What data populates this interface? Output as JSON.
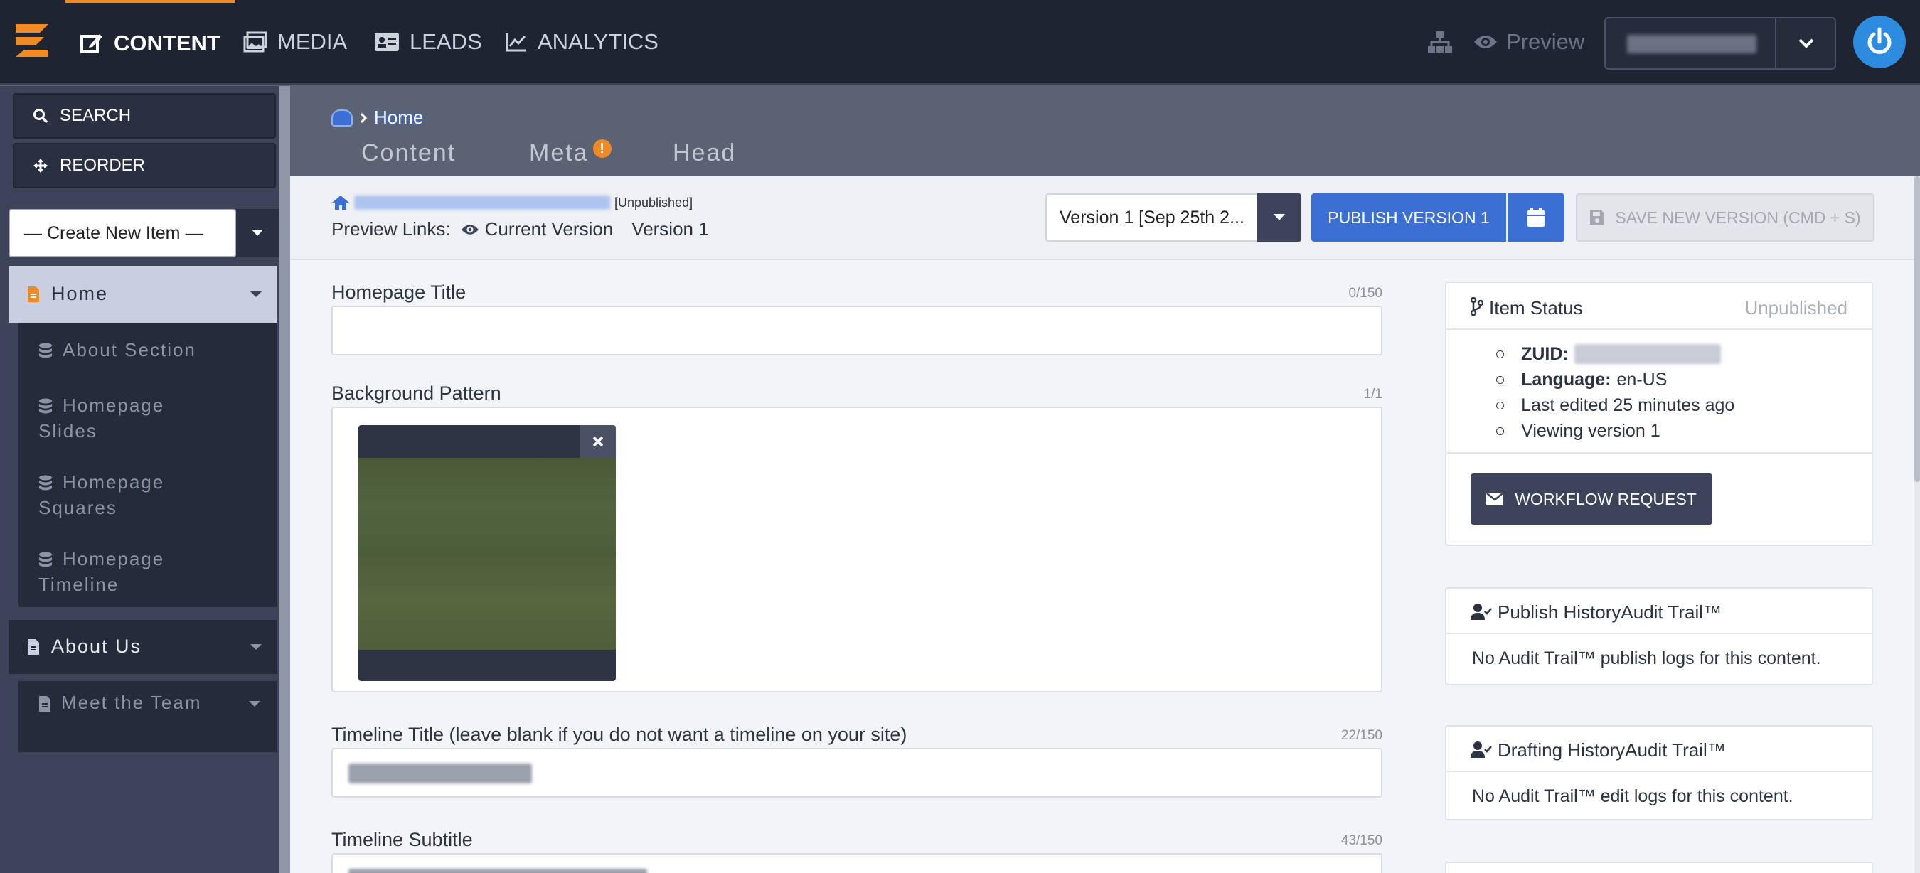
{
  "topnav": {
    "content": "CONTENT",
    "media": "MEDIA",
    "leads": "LEADS",
    "analytics": "ANALYTICS",
    "preview": "Preview"
  },
  "sidebar": {
    "search": "SEARCH",
    "reorder": "REORDER",
    "create_new": "— Create New Item —",
    "items": [
      {
        "label": "Home"
      },
      {
        "label": "About Section"
      },
      {
        "label": "Homepage Slides"
      },
      {
        "label": "Homepage Squares"
      },
      {
        "label": "Homepage Timeline"
      },
      {
        "label": "About Us"
      },
      {
        "label": "Meet the Team"
      }
    ]
  },
  "breadcrumb": {
    "current": "Home"
  },
  "tabs": {
    "content": "Content",
    "meta": "Meta",
    "meta_badge": "!",
    "head": "Head"
  },
  "version_bar": {
    "status": "[Unpublished]",
    "preview_links_label": "Preview Links:",
    "current_version": "Current Version",
    "version_link": "Version 1",
    "version_select": "Version 1 [Sep 25th 2...",
    "publish": "PUBLISH VERSION 1",
    "save": "SAVE NEW VERSION (CMD + S)"
  },
  "fields": {
    "homepage_title": {
      "label": "Homepage Title",
      "count": "0/150",
      "value": ""
    },
    "background_pattern": {
      "label": "Background Pattern",
      "count": "1/1"
    },
    "timeline_title": {
      "label": "Timeline Title (leave blank if you do not want a timeline on your site)",
      "count": "22/150"
    },
    "timeline_subtitle": {
      "label": "Timeline Subtitle",
      "count": "43/150"
    }
  },
  "item_status": {
    "title": "Item Status",
    "state": "Unpublished",
    "zuid_label": "ZUID:",
    "language_label": "Language:",
    "language": "en-US",
    "last_edited": "Last edited 25 minutes ago",
    "viewing": "Viewing version 1",
    "workflow": "WORKFLOW REQUEST"
  },
  "publish_history": {
    "title": "Publish HistoryAudit Trail™",
    "body": "No Audit Trail™ publish logs for this content."
  },
  "drafting_history": {
    "title": "Drafting HistoryAudit Trail™",
    "body": "No Audit Trail™ edit logs for this content."
  },
  "colors": {
    "accent": "#f08a24",
    "primary": "#3b6fd4",
    "dark": "#1f2433"
  }
}
